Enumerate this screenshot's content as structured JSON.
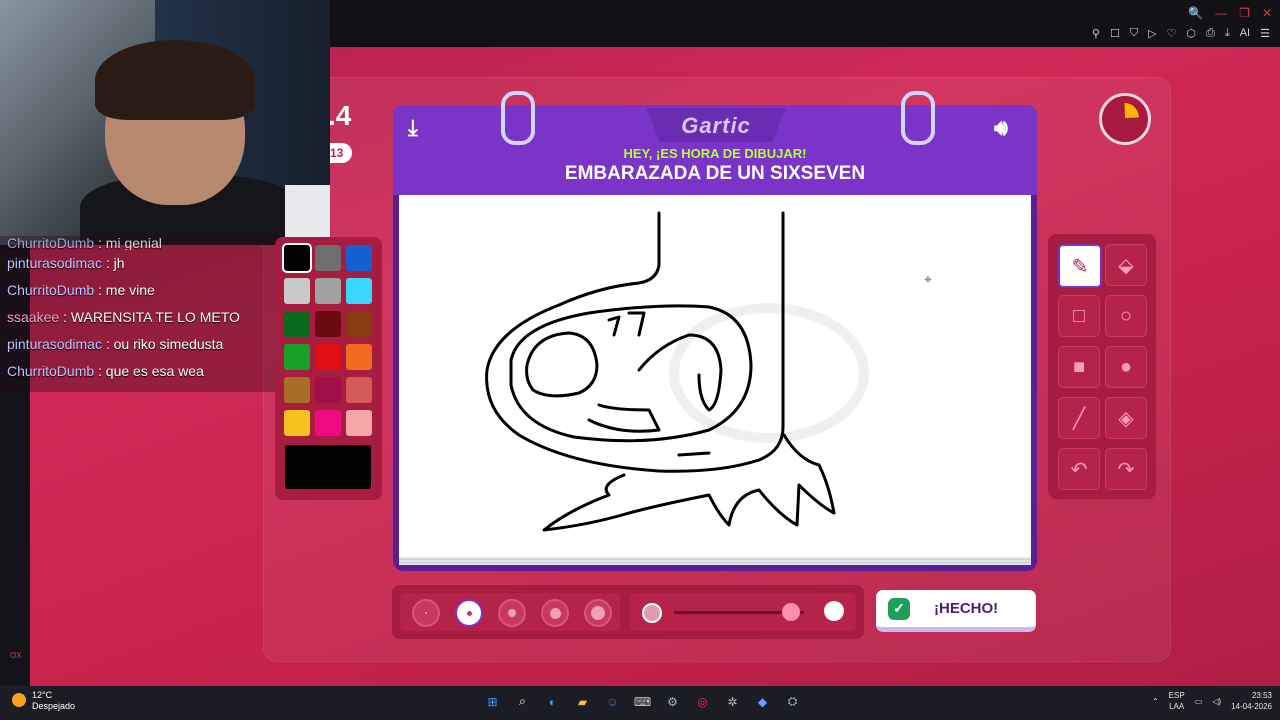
{
  "game": {
    "round_number": ".4",
    "round_badge": "13",
    "logo": "Gartic",
    "prompt_sub": "HEY, ¡ES HORA DE DIBUJAR!",
    "prompt_word": "EMBARAZADA DE UN SIXSEVEN",
    "done_label": "¡HECHO!",
    "timer_fraction_elapsed": 0.12
  },
  "chat": {
    "cut_line": {
      "user": "ChurritoDumb",
      "text": ": mi genial"
    },
    "messages": [
      {
        "user": "pinturasodimac",
        "text": ": jh"
      },
      {
        "user": "ChurritoDumb",
        "text": ": me vine"
      },
      {
        "user": "ssaakee",
        "text": ": WARENSITA TE LO METO"
      },
      {
        "user": "pinturasodimac",
        "text": ": ou riko simedusta"
      },
      {
        "user": "ChurritoDumb",
        "text": ": que es esa wea"
      }
    ]
  },
  "palette": {
    "colors": [
      "#000000",
      "#6e6e6e",
      "#1560d0",
      "#c9c9c9",
      "#a0a0a0",
      "#3ad8ff",
      "#0c6a1e",
      "#6a0a10",
      "#8a3a10",
      "#1aa028",
      "#e00e10",
      "#f26a1e",
      "#a86e28",
      "#a0104a",
      "#d45a5a",
      "#f6c21e",
      "#f00a82",
      "#f6a6a8"
    ],
    "current": "#000000"
  },
  "tools": [
    {
      "name": "pencil-tool",
      "icon": "✎",
      "active": true
    },
    {
      "name": "eraser-tool",
      "icon": "⬙",
      "active": false
    },
    {
      "name": "rectangle-outline-tool",
      "icon": "□",
      "active": false
    },
    {
      "name": "circle-outline-tool",
      "icon": "○",
      "active": false
    },
    {
      "name": "rectangle-filled-tool",
      "icon": "■",
      "active": false
    },
    {
      "name": "circle-filled-tool",
      "icon": "●",
      "active": false
    },
    {
      "name": "line-tool",
      "icon": "╱",
      "active": false
    },
    {
      "name": "fill-bucket-tool",
      "icon": "◈",
      "active": false
    },
    {
      "name": "undo-tool",
      "icon": "↶",
      "active": false
    },
    {
      "name": "redo-tool",
      "icon": "↷",
      "active": false
    }
  ],
  "brush": {
    "sizes": 5,
    "selected_size_index": 1,
    "opacity_fraction": 0.9
  },
  "browser": {
    "window_controls": [
      "🔍",
      "—",
      "❐",
      "✕"
    ],
    "toolbar": [
      "⚲",
      "☐",
      "⛉",
      "▷",
      "♡",
      "⬡",
      "⎙",
      "⤓",
      "AI",
      "☰"
    ]
  },
  "taskbar": {
    "weather_temp": "12°C",
    "weather_desc": "Despejado",
    "lang_top": "ESP",
    "lang_bottom": "LAA",
    "time": "23:53",
    "date": "14-04-2026",
    "apps": [
      "start-icon",
      "search-icon",
      "edge-icon",
      "folder-icon",
      "discord-icon",
      "code-icon",
      "steam-icon",
      "obs-icon",
      "settings-icon",
      "vs-icon",
      "steam2-icon"
    ]
  },
  "colors": {
    "accent": "#c7244c",
    "purple": "#7a35c8",
    "lime": "#b6ff3b"
  }
}
